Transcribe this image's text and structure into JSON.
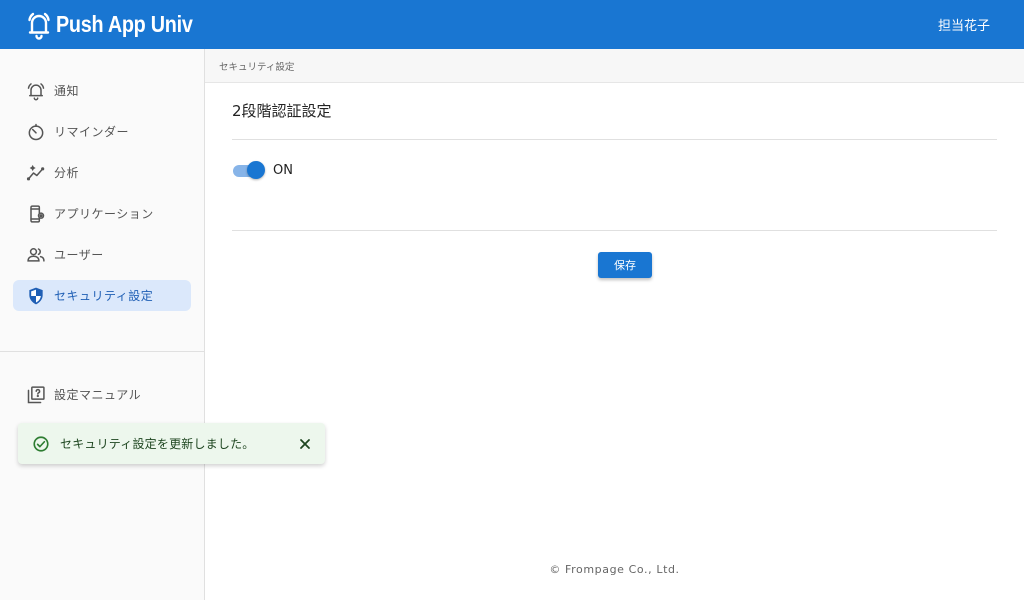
{
  "header": {
    "app_name": "Push App Univ",
    "user_name": "担当花子",
    "brand_color": "#1976d2"
  },
  "sidebar": {
    "items": [
      {
        "label": "通知",
        "icon": "bell-icon"
      },
      {
        "label": "リマインダー",
        "icon": "timer-icon"
      },
      {
        "label": "分析",
        "icon": "insights-icon"
      },
      {
        "label": "アプリケーション",
        "icon": "app-settings-icon"
      },
      {
        "label": "ユーザー",
        "icon": "people-icon"
      },
      {
        "label": "セキュリティ設定",
        "icon": "shield-icon",
        "active": true
      }
    ],
    "secondary_items": [
      {
        "label": "設定マニュアル",
        "icon": "help-book-icon"
      }
    ]
  },
  "breadcrumb": "セキュリティ設定",
  "main": {
    "section_title": "2段階認証設定",
    "toggle_label": "ON",
    "toggle_on": true,
    "save_label": "保存"
  },
  "snackbar": {
    "message": "セキュリティ設定を更新しました。",
    "icon": "check-circle-icon",
    "close_icon": "close-icon",
    "bg_color": "#edf7ed",
    "text_color": "#1e4620"
  },
  "footer": "© Frompage Co., Ltd."
}
